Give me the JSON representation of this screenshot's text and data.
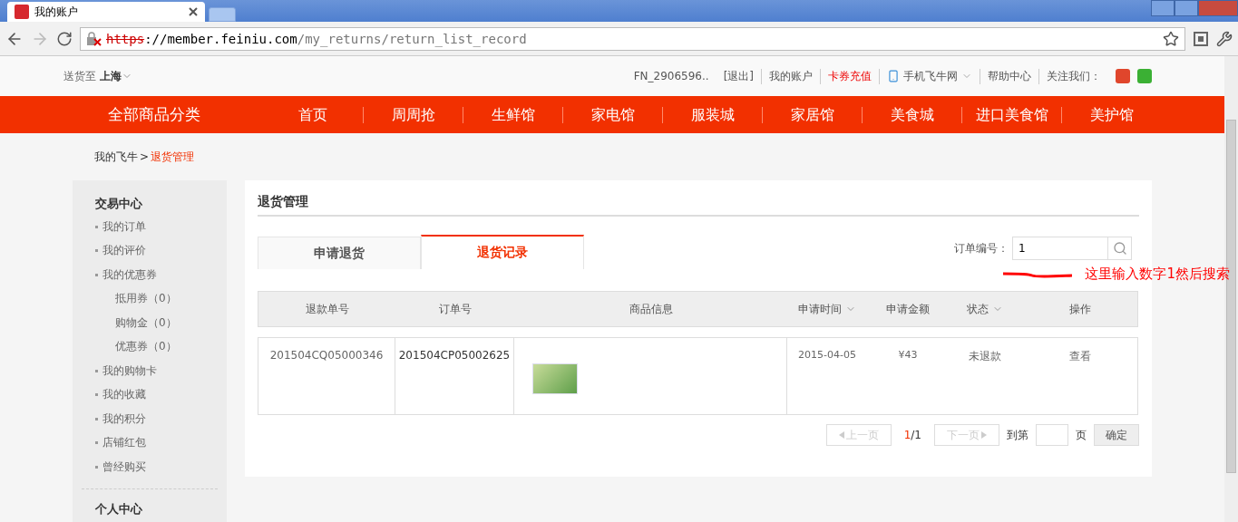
{
  "browser": {
    "tab_title": "我的账户",
    "url_scheme": "https",
    "url_host": "://member.feiniu.com",
    "url_path": "/my_returns/return_list_record"
  },
  "topbar": {
    "delivery_label": "送货至",
    "delivery_city": "上海",
    "user": "FN_2906596..",
    "logout": "[退出]",
    "links": [
      {
        "text": "我的账户",
        "kind": "plain"
      },
      {
        "text": "卡券充值",
        "kind": "highlight"
      },
      {
        "text": "手机飞牛网",
        "kind": "mobile"
      },
      {
        "text": "帮助中心",
        "kind": "plain"
      },
      {
        "text": "关注我们：",
        "kind": "follow"
      }
    ]
  },
  "nav": {
    "category": "全部商品分类",
    "items": [
      "首页",
      "周周抢",
      "生鲜馆",
      "家电馆",
      "服装城",
      "家居馆",
      "美食城",
      "进口美食馆",
      "美护馆"
    ]
  },
  "breadcrumb": {
    "parent": "我的飞牛",
    "separator": ">",
    "current": "退货管理"
  },
  "sidebar": [
    {
      "title": "交易中心",
      "items": [
        {
          "label": "我的订单"
        },
        {
          "label": "我的评价"
        },
        {
          "label": "我的优惠券",
          "children": [
            {
              "label": "抵用券（0）"
            },
            {
              "label": "购物金（0）"
            },
            {
              "label": "优惠券（0）"
            }
          ]
        },
        {
          "label": "我的购物卡"
        },
        {
          "label": "我的收藏"
        },
        {
          "label": "我的积分"
        },
        {
          "label": "店铺红包"
        },
        {
          "label": "曾经购买"
        }
      ]
    },
    {
      "title": "个人中心"
    }
  ],
  "panel": {
    "title": "退货管理",
    "tabs": [
      {
        "label": "申请退货",
        "selected": false
      },
      {
        "label": "退货记录",
        "selected": true
      }
    ],
    "search": {
      "label": "订单编号：",
      "value": "1"
    },
    "annotation": "这里输入数字1然后搜索",
    "table": {
      "columns": [
        {
          "label": "退款单号",
          "sortable": false
        },
        {
          "label": "订单号",
          "sortable": false
        },
        {
          "label": "商品信息",
          "sortable": false
        },
        {
          "label": "申请时间",
          "sortable": true
        },
        {
          "label": "申请金额",
          "sortable": false
        },
        {
          "label": "状态",
          "sortable": true
        },
        {
          "label": "操作",
          "sortable": false
        }
      ],
      "rows": [
        {
          "refund_no": "201504CQ05000346",
          "order_no": "201504CP05002625",
          "date": "2015-04-05",
          "amount": "¥43",
          "status": "未退款",
          "action": "查看"
        }
      ]
    },
    "pagination": {
      "prev": "上一页",
      "current": "1",
      "total": "/1",
      "next": "下一页",
      "goto": "到第",
      "unit": "页",
      "confirm": "确定"
    }
  }
}
